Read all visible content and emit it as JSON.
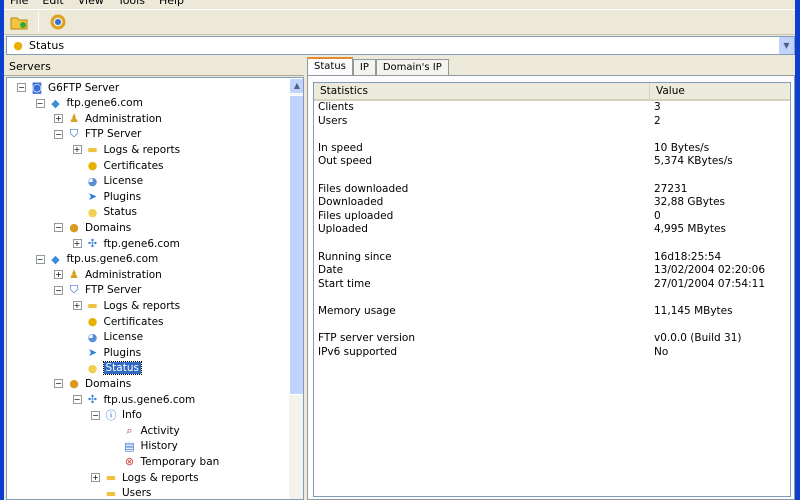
{
  "menu": [
    "File",
    "Edit",
    "View",
    "Tools",
    "Help"
  ],
  "toolbar": [
    {
      "icon": "open-folder-icon"
    },
    {
      "icon": "refresh-icon"
    }
  ],
  "address": {
    "icon": "lightbulb-icon",
    "value": "Status"
  },
  "left_panel": {
    "title": "Servers"
  },
  "tree": [
    {
      "label": "G6FTP Server",
      "level": 0,
      "exp": "-",
      "icon": "server-icon"
    },
    {
      "label": "ftp.gene6.com",
      "level": 1,
      "exp": "-",
      "icon": "host-icon"
    },
    {
      "label": "Administration",
      "level": 2,
      "exp": "+",
      "icon": "admin-icon"
    },
    {
      "label": "FTP Server",
      "level": 2,
      "exp": "-",
      "icon": "shield-icon"
    },
    {
      "label": "Logs & reports",
      "level": 3,
      "exp": "+",
      "icon": "folder-icon"
    },
    {
      "label": "Certificates",
      "level": 3,
      "exp": "",
      "icon": "certificate-icon"
    },
    {
      "label": "License",
      "level": 3,
      "exp": "",
      "icon": "license-icon"
    },
    {
      "label": "Plugins",
      "level": 3,
      "exp": "",
      "icon": "plugin-icon"
    },
    {
      "label": "Status",
      "level": 3,
      "exp": "",
      "icon": "lightbulb-icon"
    },
    {
      "label": "Domains",
      "level": 2,
      "exp": "-",
      "icon": "globe-icon"
    },
    {
      "label": "ftp.gene6.com",
      "level": 3,
      "exp": "+",
      "icon": "domain-icon"
    },
    {
      "label": "ftp.us.gene6.com",
      "level": 1,
      "exp": "-",
      "icon": "host-icon"
    },
    {
      "label": "Administration",
      "level": 2,
      "exp": "+",
      "icon": "admin-icon"
    },
    {
      "label": "FTP Server",
      "level": 2,
      "exp": "-",
      "icon": "shield-icon"
    },
    {
      "label": "Logs & reports",
      "level": 3,
      "exp": "+",
      "icon": "folder-icon"
    },
    {
      "label": "Certificates",
      "level": 3,
      "exp": "",
      "icon": "certificate-icon"
    },
    {
      "label": "License",
      "level": 3,
      "exp": "",
      "icon": "license-icon"
    },
    {
      "label": "Plugins",
      "level": 3,
      "exp": "",
      "icon": "plugin-icon"
    },
    {
      "label": "Status",
      "level": 3,
      "exp": "",
      "icon": "lightbulb-icon",
      "selected": true
    },
    {
      "label": "Domains",
      "level": 2,
      "exp": "-",
      "icon": "globe-icon"
    },
    {
      "label": "ftp.us.gene6.com",
      "level": 3,
      "exp": "-",
      "icon": "domain-icon"
    },
    {
      "label": "Info",
      "level": 4,
      "exp": "-",
      "icon": "info-icon"
    },
    {
      "label": "Activity",
      "level": 5,
      "exp": "",
      "icon": "activity-icon"
    },
    {
      "label": "History",
      "level": 5,
      "exp": "",
      "icon": "history-icon"
    },
    {
      "label": "Temporary ban",
      "level": 5,
      "exp": "",
      "icon": "ban-icon"
    },
    {
      "label": "Logs & reports",
      "level": 4,
      "exp": "+",
      "icon": "folder-icon"
    },
    {
      "label": "Users",
      "level": 4,
      "exp": "",
      "icon": "folder-icon"
    }
  ],
  "tabs": [
    {
      "label": "Status",
      "active": true
    },
    {
      "label": "IP"
    },
    {
      "label": "Domain's IP"
    }
  ],
  "stats": {
    "headers": [
      "Statistics",
      "Value"
    ],
    "rows": [
      [
        "Clients",
        "3"
      ],
      [
        "Users",
        "2"
      ],
      null,
      [
        "In speed",
        "10 Bytes/s"
      ],
      [
        "Out speed",
        "5,374 KBytes/s"
      ],
      null,
      [
        "Files downloaded",
        "27231"
      ],
      [
        "Downloaded",
        "32,88 GBytes"
      ],
      [
        "Files uploaded",
        "0"
      ],
      [
        "Uploaded",
        "4,995 MBytes"
      ],
      null,
      [
        "Running since",
        "16d18:25:54"
      ],
      [
        "Date",
        "13/02/2004 02:20:06"
      ],
      [
        "Start time",
        "27/01/2004 07:54:11"
      ],
      null,
      [
        "Memory usage",
        "11,145 MBytes"
      ],
      null,
      [
        "FTP server version",
        "v0.0.0  (Build 31)"
      ],
      [
        "IPv6 supported",
        "No"
      ]
    ]
  }
}
